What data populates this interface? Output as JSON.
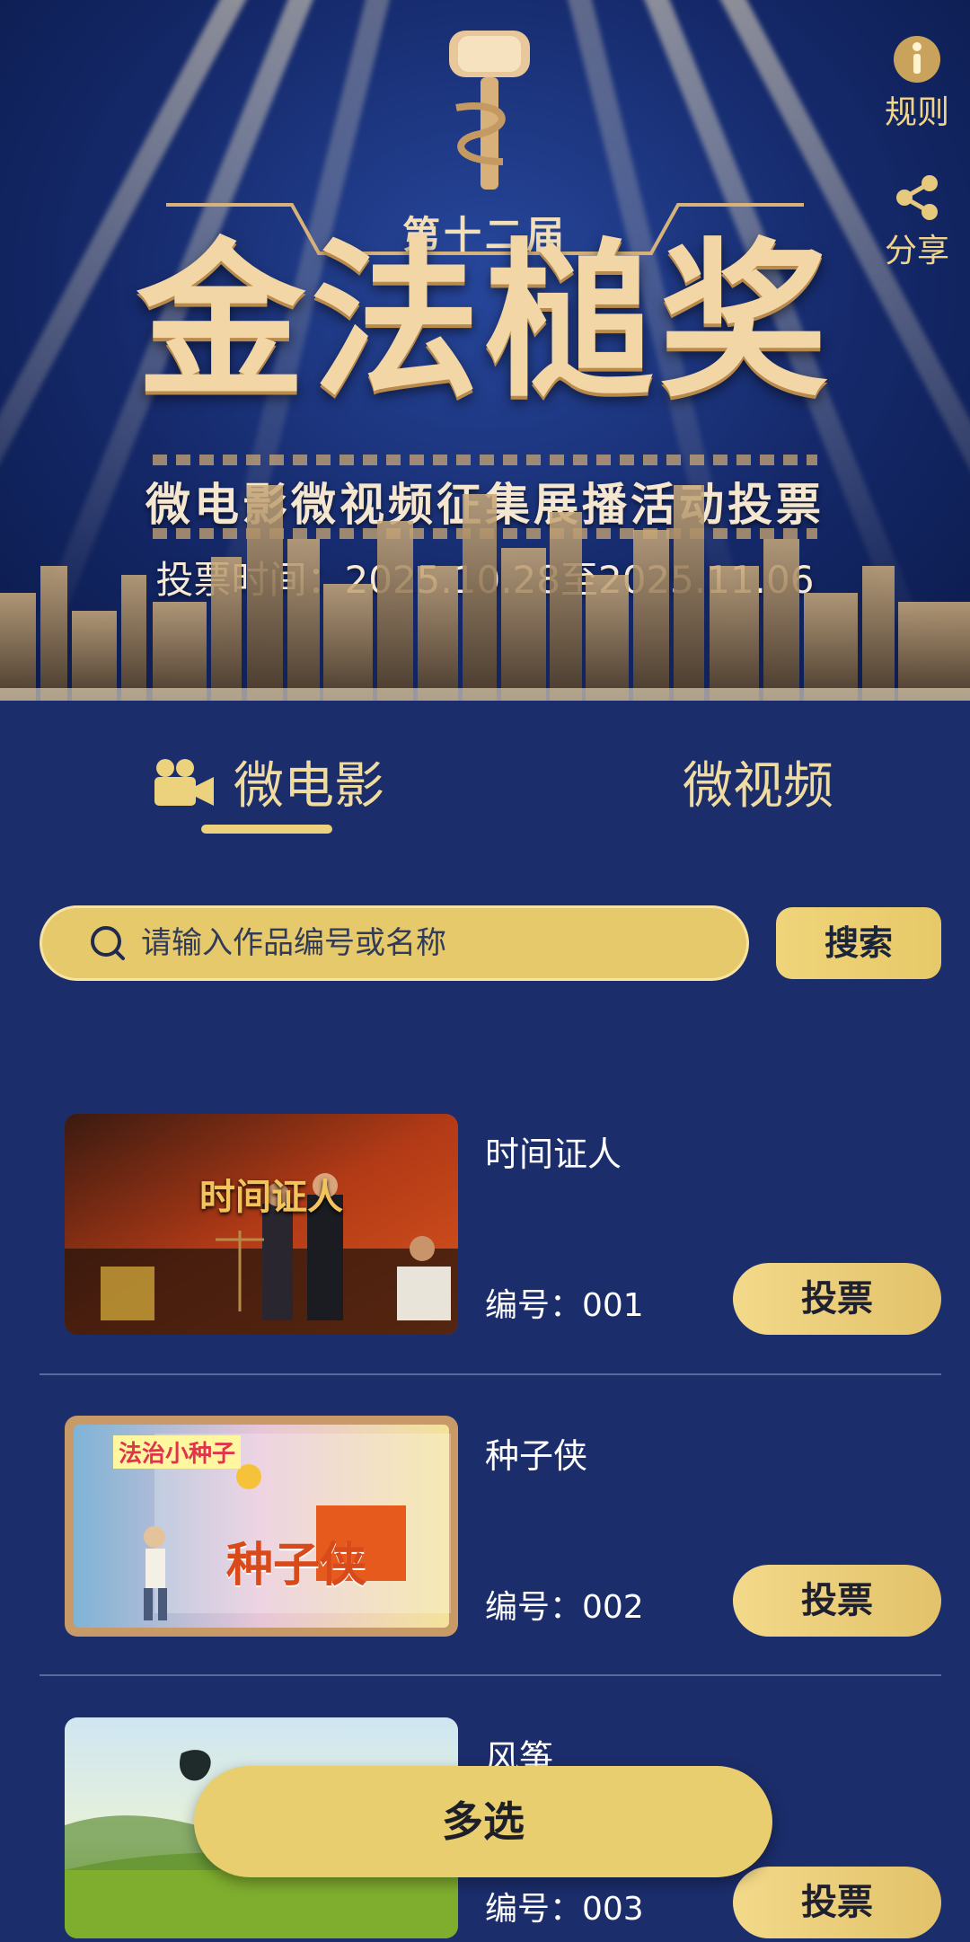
{
  "banner": {
    "edition": "第十二届",
    "title": "金法槌奖",
    "subtitle": "微电影微视频征集展播活动投票",
    "vote_time": "投票时间：2025.10.28至2025.11.06"
  },
  "side_actions": {
    "rules_label": "规则",
    "share_label": "分享"
  },
  "tabs": [
    {
      "label": "微电影",
      "active": true
    },
    {
      "label": "微视频",
      "active": false
    }
  ],
  "search": {
    "placeholder": "请输入作品编号或名称",
    "value": "",
    "button_label": "搜索"
  },
  "items": [
    {
      "title": "时间证人",
      "id_label": "编号：001",
      "vote_label": "投票",
      "thumb_text": "时间证人"
    },
    {
      "title": "种子侠",
      "id_label": "编号：002",
      "vote_label": "投票",
      "thumb_text": "种子侠",
      "thumb_tag": "法治小种子"
    },
    {
      "title": "风筝",
      "id_label": "编号：003",
      "vote_label": "投票"
    }
  ],
  "multi_select_label": "多选",
  "colors": {
    "page_bg": "#1b2d6b",
    "gold": "#e8ce6e",
    "tab_text": "#f1dca0"
  }
}
